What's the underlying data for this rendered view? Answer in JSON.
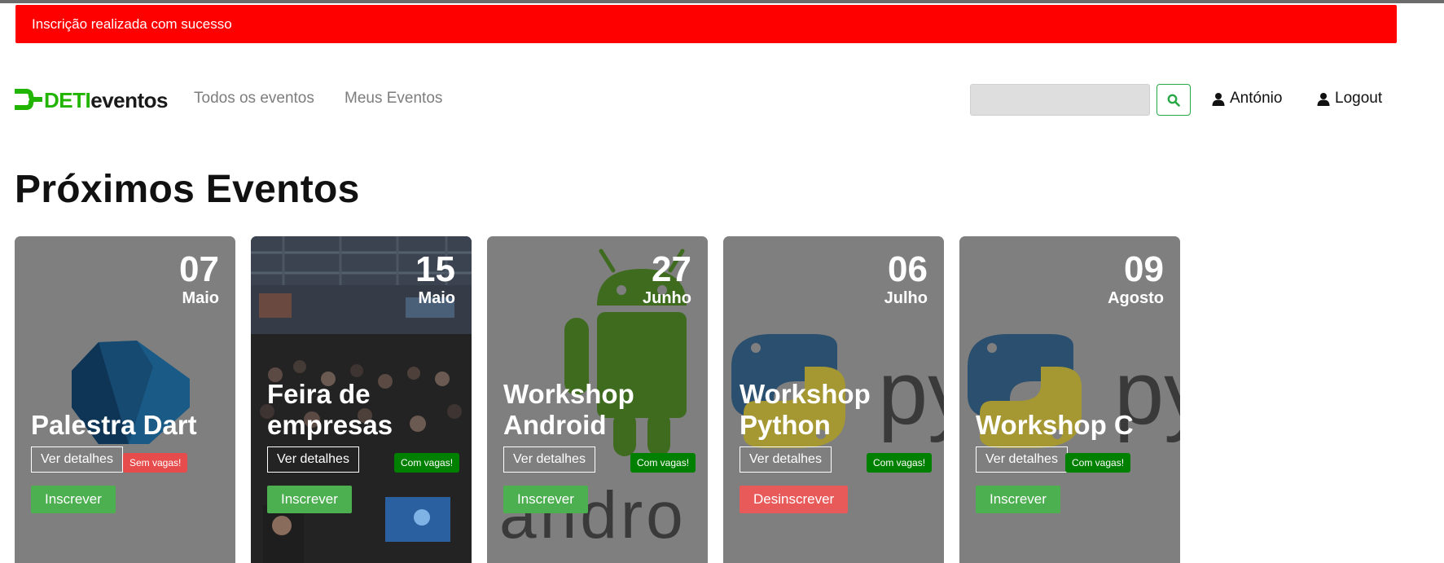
{
  "alert": {
    "message": "Inscrição realizada com sucesso"
  },
  "brand": {
    "part1": "DETI",
    "part2": "eventos",
    "accent": "#21b400"
  },
  "nav": {
    "links": [
      {
        "label": "Todos os eventos"
      },
      {
        "label": "Meus Eventos"
      }
    ],
    "search": {
      "value": "",
      "placeholder": "",
      "icon": "search-icon"
    },
    "user": {
      "label": "António",
      "icon": "user-icon"
    },
    "logout": {
      "label": "Logout",
      "icon": "user-icon"
    }
  },
  "page": {
    "title": "Próximos Eventos"
  },
  "events": [
    {
      "day": "07",
      "month": "Maio",
      "title": "Palestra Dart",
      "details_label": "Ver detalhes",
      "badge": "Sem vagas!",
      "badge_status": "full",
      "action": "Inscrever",
      "action_status": "green",
      "image": "dart-logo"
    },
    {
      "day": "15",
      "month": "Maio",
      "title": "Feira de empresas",
      "details_label": "Ver detalhes",
      "badge": "Com vagas!",
      "badge_status": "open",
      "action": "Inscrever",
      "action_status": "green",
      "image": "fair-photo"
    },
    {
      "day": "27",
      "month": "Junho",
      "title": "Workshop Android",
      "details_label": "Ver detalhes",
      "badge": "Com vagas!",
      "badge_status": "open",
      "action": "Inscrever",
      "action_status": "green",
      "image": "android-logo"
    },
    {
      "day": "06",
      "month": "Julho",
      "title": "Workshop Python",
      "details_label": "Ver detalhes",
      "badge": "Com vagas!",
      "badge_status": "open",
      "action": "Desinscrever",
      "action_status": "red",
      "image": "python-logo"
    },
    {
      "day": "09",
      "month": "Agosto",
      "title": "Workshop C",
      "details_label": "Ver detalhes",
      "badge": "Com vagas!",
      "badge_status": "open",
      "action": "Inscrever",
      "action_status": "green",
      "image": "python-logo"
    }
  ],
  "colors": {
    "alert": "#ff0000",
    "card": "#7f7f7f",
    "badge_full": "#e74c4c",
    "badge_open": "#008000",
    "btn_green": "#4caf50",
    "btn_red": "#e85a5a"
  }
}
